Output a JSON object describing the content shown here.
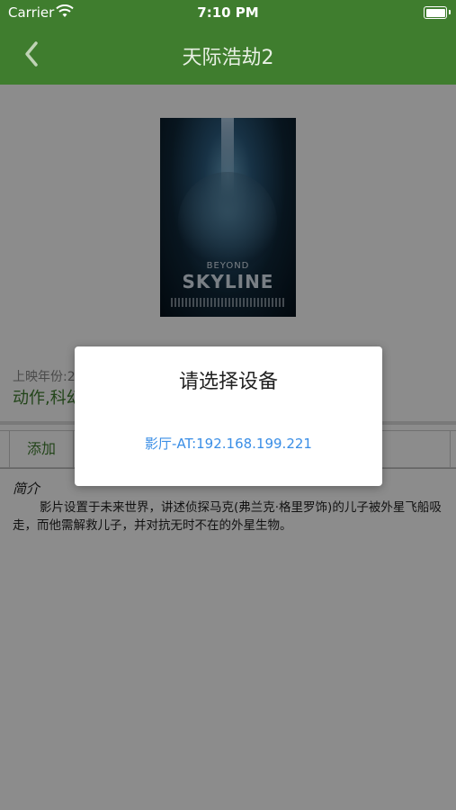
{
  "status_bar": {
    "carrier": "Carrier",
    "time": "7:10 PM"
  },
  "nav": {
    "title": "天际浩劫2",
    "back_icon": "chevron-left-icon"
  },
  "poster": {
    "line1": "BEYOND",
    "line2": "SKYLINE"
  },
  "info": {
    "year": "上映年份:2",
    "genre": "动作,科幻"
  },
  "actions": {
    "add_label": "添加"
  },
  "intro": {
    "title": "简介",
    "text": "影片设置于未来世界，讲述侦探马克(弗兰克·格里罗饰)的儿子被外星飞船吸走，而他需解救儿子，并对抗无时不在的外星生物。"
  },
  "dialog": {
    "title": "请选择设备",
    "devices": [
      "影厅-AT:192.168.199.221"
    ]
  },
  "colors": {
    "nav_bg": "#3f7d2e",
    "accent": "#3f7d2e",
    "link": "#3a8ee6"
  }
}
